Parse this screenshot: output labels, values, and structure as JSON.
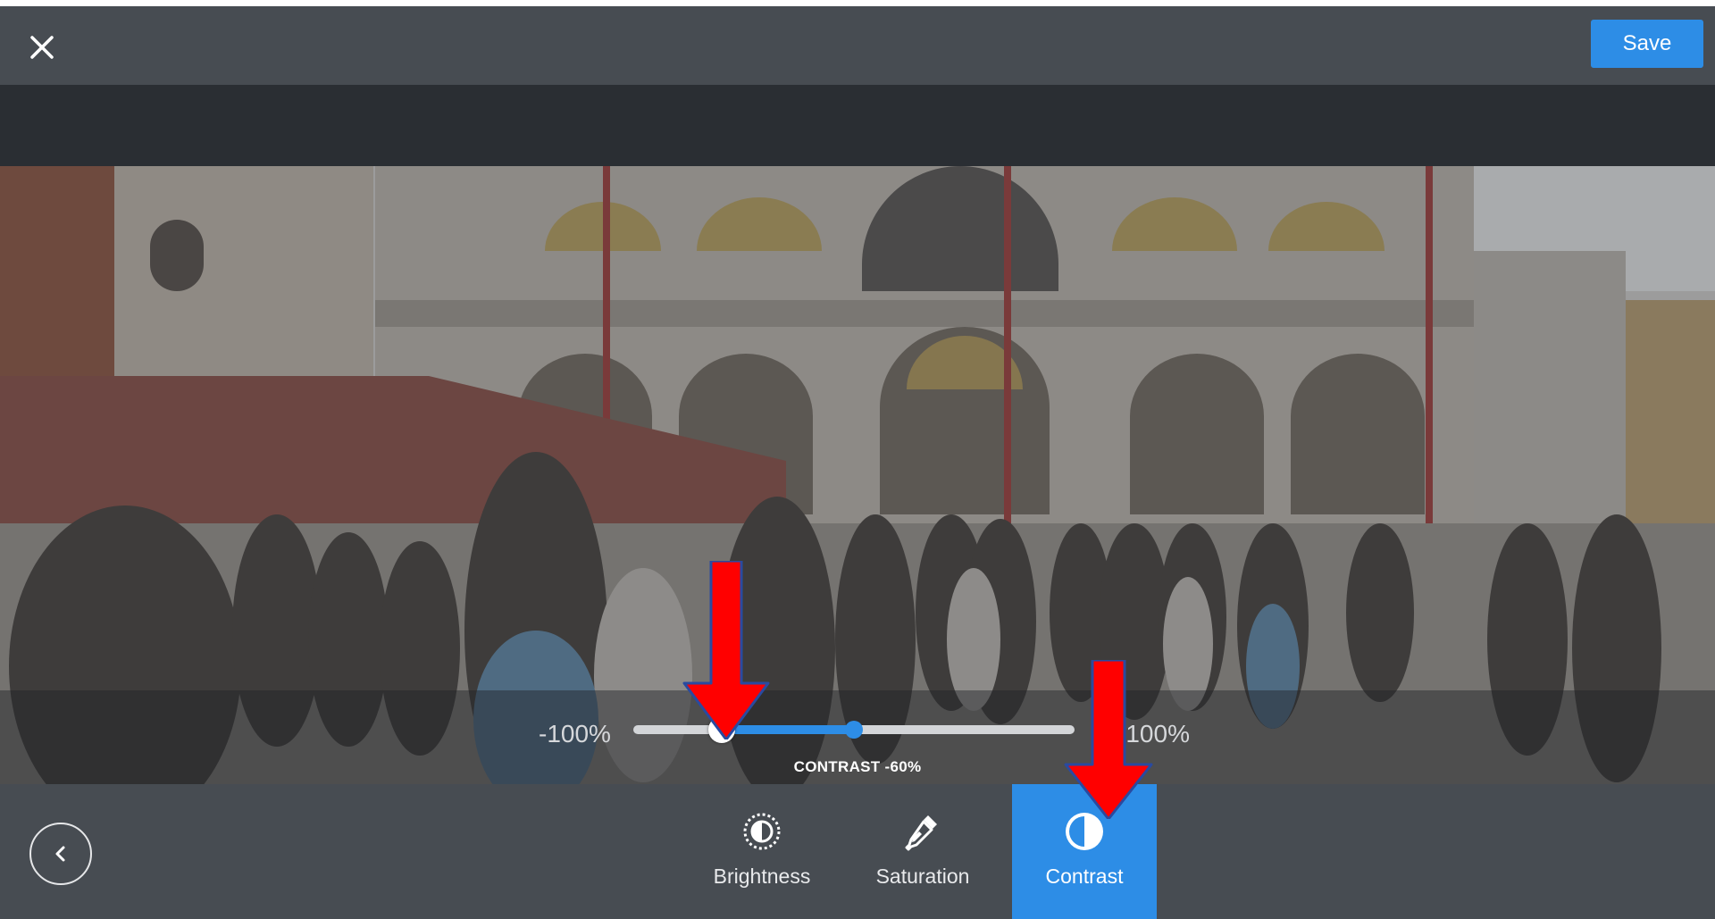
{
  "header": {
    "close_icon": "close-icon",
    "save_label": "Save"
  },
  "adjust": {
    "min_label": "-100%",
    "max_label": "+100%",
    "value_text": "CONTRAST -60%",
    "value_percent": -60,
    "min": -100,
    "max": 100
  },
  "toolbar": {
    "back_icon": "chevron-left-icon",
    "tools": [
      {
        "label": "Brightness",
        "icon": "brightness-icon",
        "active": false
      },
      {
        "label": "Saturation",
        "icon": "eyedropper-icon",
        "active": false
      },
      {
        "label": "Contrast",
        "icon": "contrast-icon",
        "active": true
      }
    ]
  },
  "colors": {
    "accent": "#2d8de6",
    "bar": "#474c52",
    "annotation_arrow": "#ff0000"
  }
}
